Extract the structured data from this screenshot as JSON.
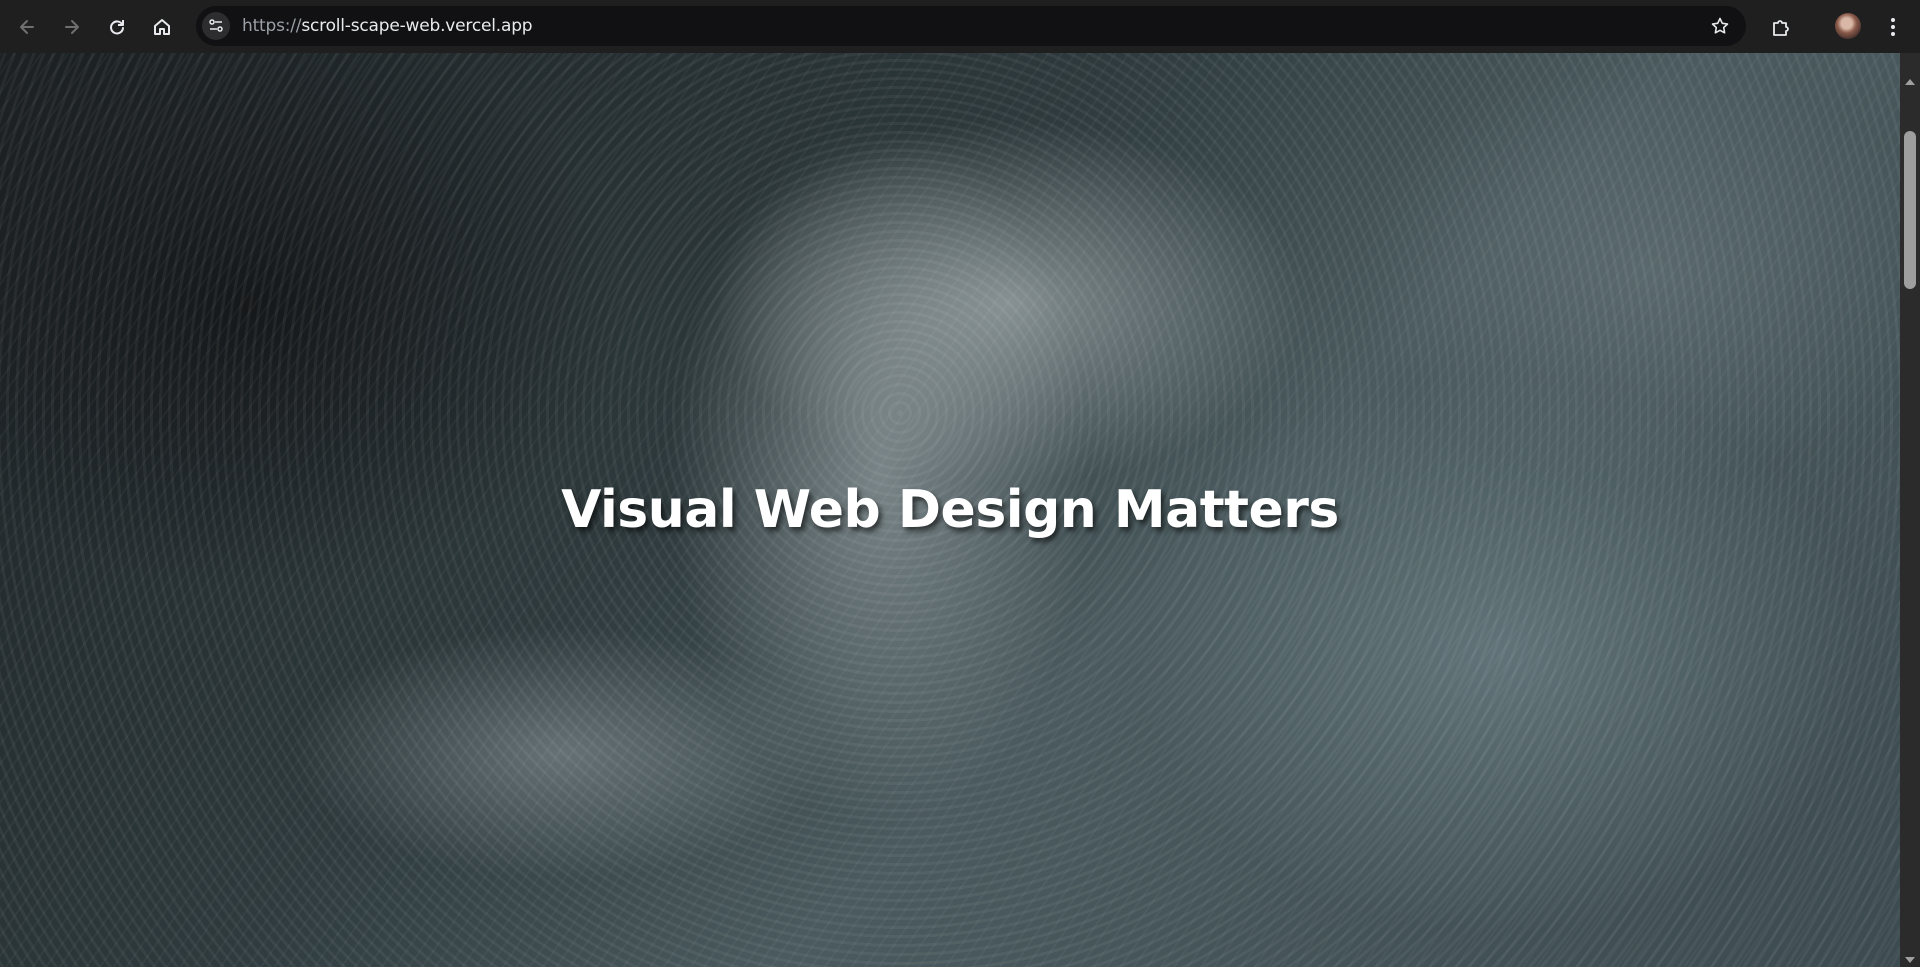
{
  "browser": {
    "url_scheme": "https://",
    "url_host": "scroll-scape-web.vercel.app",
    "icons": {
      "back": "arrow-left-icon",
      "forward": "arrow-right-icon",
      "reload": "reload-icon",
      "home": "home-icon",
      "site_info": "tune-icon",
      "bookmark": "star-icon",
      "extensions": "puzzle-icon",
      "profile": "avatar",
      "menu": "kebab-menu-icon"
    }
  },
  "page": {
    "hero_title": "Visual Web Design Matters",
    "colors": {
      "title": "#ffffff",
      "toolbar": "#1f1f1f",
      "omnibox": "#111113"
    }
  }
}
